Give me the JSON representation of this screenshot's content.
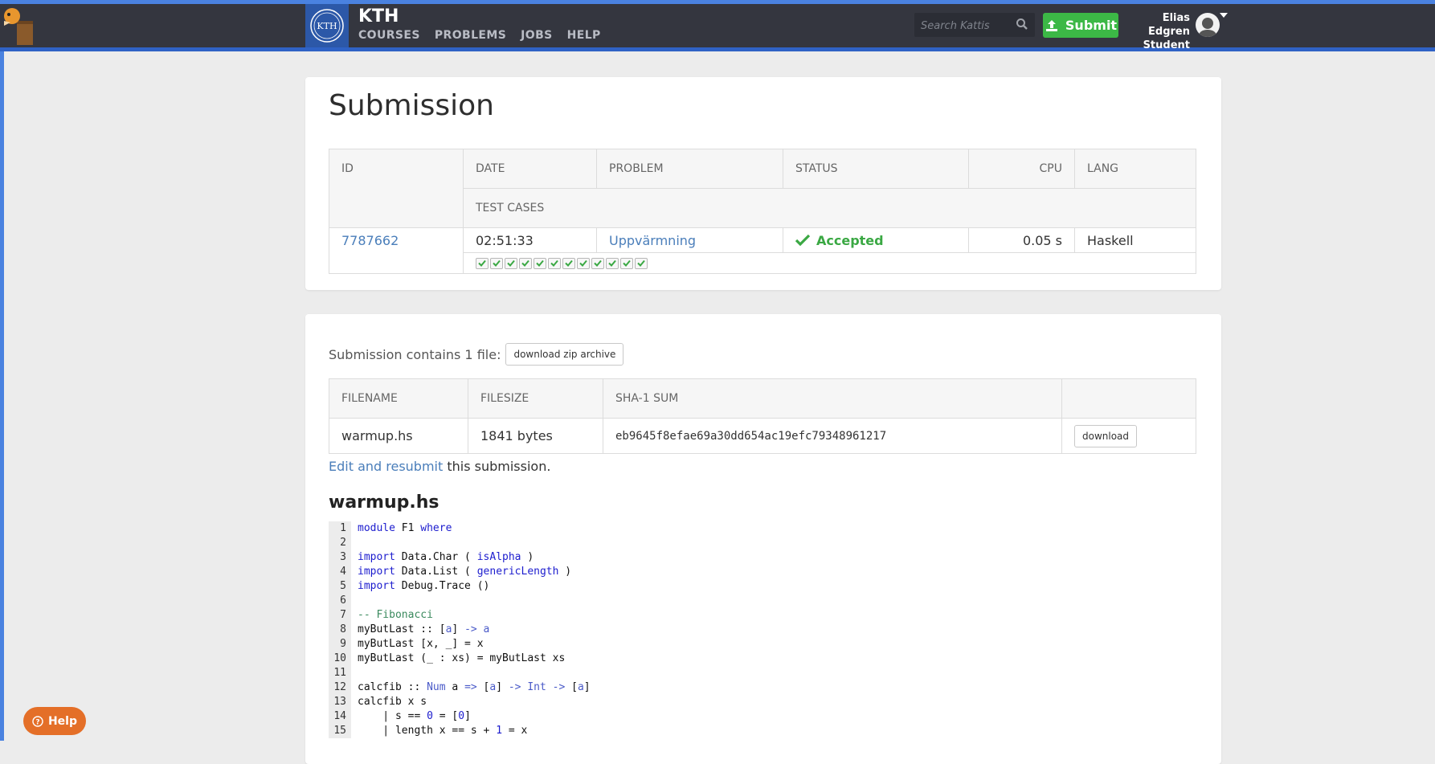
{
  "header": {
    "brand": "KTH",
    "logo_text": "KTH",
    "nav": [
      "COURSES",
      "PROBLEMS",
      "JOBS",
      "HELP"
    ],
    "search_placeholder": "Search Kattis",
    "submit_label": "Submit",
    "user_name": "Elias Edgren",
    "user_role": "Student"
  },
  "submission": {
    "title": "Submission",
    "headers": {
      "id": "ID",
      "date": "DATE",
      "problem": "PROBLEM",
      "status": "STATUS",
      "cpu": "CPU",
      "lang": "LANG",
      "test_cases": "TEST CASES"
    },
    "row": {
      "id": "7787662",
      "date": "02:51:33",
      "problem": "Uppvärmning",
      "status": "Accepted",
      "cpu": "0.05 s",
      "lang": "Haskell"
    },
    "test_cases_passed": 12,
    "test_cases_total": 12
  },
  "files": {
    "contains_text": "Submission contains 1 file:",
    "zip_button": "download zip archive",
    "headers": {
      "filename": "FILENAME",
      "filesize": "FILESIZE",
      "sha": "SHA-1 SUM"
    },
    "row": {
      "filename": "warmup.hs",
      "filesize": "1841 bytes",
      "sha": "eb9645f8efae69a30dd654ac19efc79348961217",
      "download": "download"
    },
    "resubmit_link": "Edit and resubmit",
    "resubmit_rest": " this submission.",
    "code_title": "warmup.hs"
  },
  "code_lines": [
    {
      "n": "1",
      "t": "module F1 where"
    },
    {
      "n": "2",
      "t": ""
    },
    {
      "n": "3",
      "t": "import Data.Char ( isAlpha )"
    },
    {
      "n": "4",
      "t": "import Data.List ( genericLength )"
    },
    {
      "n": "5",
      "t": "import Debug.Trace ()"
    },
    {
      "n": "6",
      "t": ""
    },
    {
      "n": "7",
      "t": "-- Fibonacci"
    },
    {
      "n": "8",
      "t": "myButLast :: [a] -> a"
    },
    {
      "n": "9",
      "t": "myButLast [x, _] = x"
    },
    {
      "n": "10",
      "t": "myButLast (_ : xs) = myButLast xs"
    },
    {
      "n": "11",
      "t": ""
    },
    {
      "n": "12",
      "t": "calcfib :: Num a => [a] -> Int -> [a]"
    },
    {
      "n": "13",
      "t": "calcfib x s"
    },
    {
      "n": "14",
      "t": "    | s == 0 = [0]"
    },
    {
      "n": "15",
      "t": "    | length x == s + 1 = x"
    }
  ],
  "help_button": "Help",
  "colors": {
    "accent": "#4a82e0",
    "topbar": "#34363f",
    "submit_green": "#3cb846",
    "accepted": "#3aa843",
    "link": "#4a7eba",
    "help": "#e46f28"
  }
}
